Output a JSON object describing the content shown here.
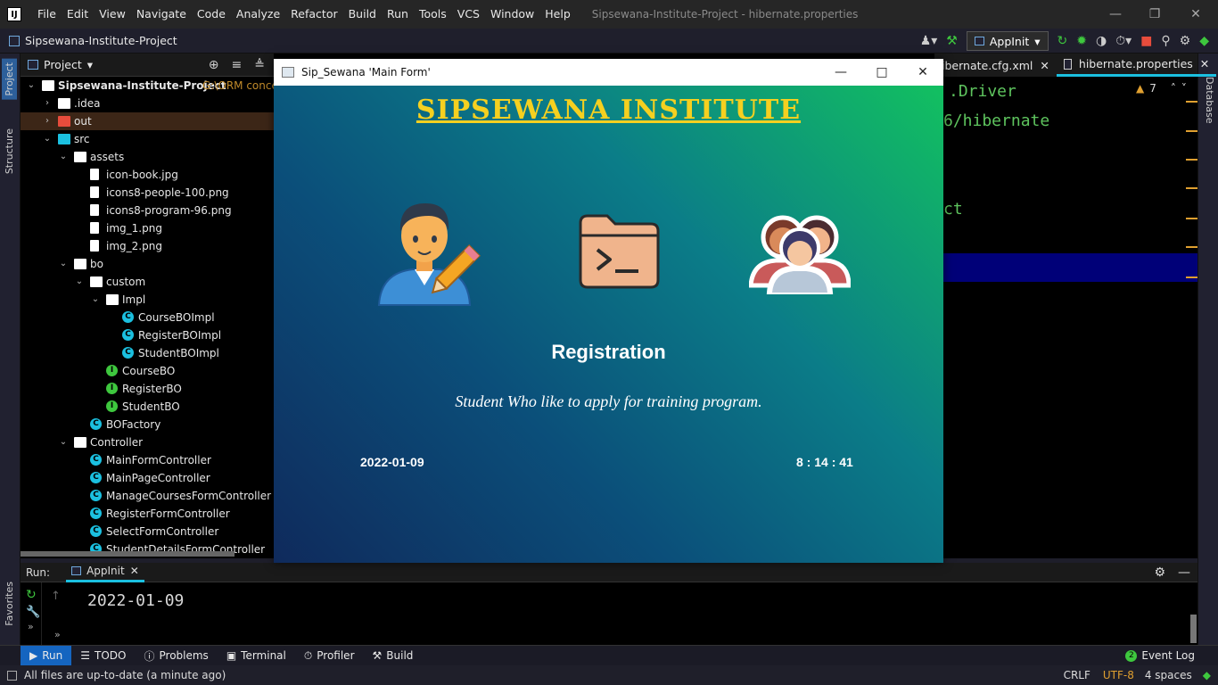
{
  "menubar": {
    "items": [
      "File",
      "Edit",
      "View",
      "Navigate",
      "Code",
      "Analyze",
      "Refactor",
      "Build",
      "Run",
      "Tools",
      "VCS",
      "Window",
      "Help"
    ],
    "window_title": "Sipsewana-Institute-Project - hibernate.properties"
  },
  "navbar": {
    "project": "Sipsewana-Institute-Project",
    "run_config": "AppInit"
  },
  "sidebar_left": {
    "project_tab": "Project",
    "structure_tab": "Structure",
    "favorites_tab": "Favorites"
  },
  "sidebar_right": {
    "database_tab": "Database"
  },
  "project_panel": {
    "title": "Project",
    "root": "Sipsewana-Institute-Project",
    "root_path": "G:\\ORM concep",
    "tree": [
      {
        "label": "Sipsewana-Institute-Project",
        "depth": 0,
        "arrow": "open",
        "icon": "folder"
      },
      {
        "label": ".idea",
        "depth": 1,
        "arrow": "closed",
        "icon": "folder"
      },
      {
        "label": "out",
        "depth": 1,
        "arrow": "closed",
        "icon": "folder-red",
        "selected": true
      },
      {
        "label": "src",
        "depth": 1,
        "arrow": "open",
        "icon": "folder-cyan"
      },
      {
        "label": "assets",
        "depth": 2,
        "arrow": "open",
        "icon": "package"
      },
      {
        "label": "icon-book.jpg",
        "depth": 3,
        "arrow": "none",
        "icon": "file"
      },
      {
        "label": "icons8-people-100.png",
        "depth": 3,
        "arrow": "none",
        "icon": "file"
      },
      {
        "label": "icons8-program-96.png",
        "depth": 3,
        "arrow": "none",
        "icon": "file"
      },
      {
        "label": "img_1.png",
        "depth": 3,
        "arrow": "none",
        "icon": "file"
      },
      {
        "label": "img_2.png",
        "depth": 3,
        "arrow": "none",
        "icon": "file"
      },
      {
        "label": "bo",
        "depth": 2,
        "arrow": "open",
        "icon": "package"
      },
      {
        "label": "custom",
        "depth": 3,
        "arrow": "open",
        "icon": "package"
      },
      {
        "label": "Impl",
        "depth": 4,
        "arrow": "open",
        "icon": "package"
      },
      {
        "label": "CourseBOImpl",
        "depth": 5,
        "arrow": "none",
        "icon": "class"
      },
      {
        "label": "RegisterBOImpl",
        "depth": 5,
        "arrow": "none",
        "icon": "class"
      },
      {
        "label": "StudentBOImpl",
        "depth": 5,
        "arrow": "none",
        "icon": "class"
      },
      {
        "label": "CourseBO",
        "depth": 4,
        "arrow": "none",
        "icon": "interface"
      },
      {
        "label": "RegisterBO",
        "depth": 4,
        "arrow": "none",
        "icon": "interface"
      },
      {
        "label": "StudentBO",
        "depth": 4,
        "arrow": "none",
        "icon": "interface"
      },
      {
        "label": "BOFactory",
        "depth": 3,
        "arrow": "none",
        "icon": "class"
      },
      {
        "label": "Controller",
        "depth": 2,
        "arrow": "open",
        "icon": "package"
      },
      {
        "label": "MainFormController",
        "depth": 3,
        "arrow": "none",
        "icon": "class"
      },
      {
        "label": "MainPageController",
        "depth": 3,
        "arrow": "none",
        "icon": "class"
      },
      {
        "label": "ManageCoursesFormController",
        "depth": 3,
        "arrow": "none",
        "icon": "class"
      },
      {
        "label": "RegisterFormController",
        "depth": 3,
        "arrow": "none",
        "icon": "class"
      },
      {
        "label": "SelectFormController",
        "depth": 3,
        "arrow": "none",
        "icon": "class"
      },
      {
        "label": "StudentDetailsFormController",
        "depth": 3,
        "arrow": "none",
        "icon": "class"
      }
    ]
  },
  "editor": {
    "tabs": [
      "ibernate.cfg.xml",
      "hibernate.properties"
    ],
    "active_tab": "hibernate.properties",
    "warnings": "7",
    "code_fragments": [
      ".Driver",
      "6/hibernate",
      "ct"
    ]
  },
  "dialog": {
    "title": "Sip_Sewana 'Main Form'",
    "brand": "SIPSEWANA INSTITUTE",
    "heading": "Registration",
    "description": "Student Who like to apply for training program.",
    "date": "2022-01-09",
    "time": "8 : 14 : 41"
  },
  "run_panel": {
    "label": "Run:",
    "tab": "AppInit",
    "output": "2022-01-09"
  },
  "bottom_tools": [
    "Run",
    "TODO",
    "Problems",
    "Terminal",
    "Profiler",
    "Build"
  ],
  "event_log": {
    "count": "2",
    "label": "Event Log"
  },
  "status": {
    "message": "All files are up-to-date (a minute ago)",
    "line_sep": "CRLF",
    "encoding": "UTF-8",
    "indent": "4 spaces"
  }
}
